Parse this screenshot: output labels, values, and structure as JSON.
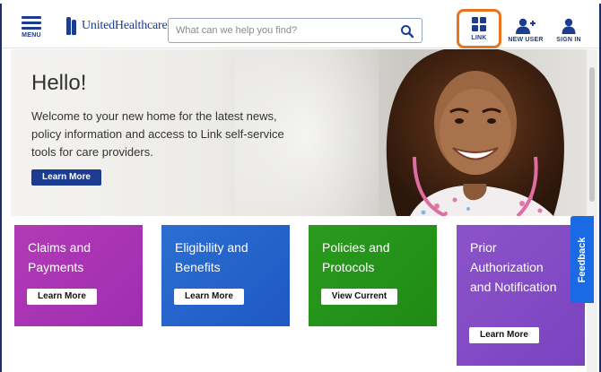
{
  "topstrip": {
    "link_text": "",
    "tail_text": ""
  },
  "header": {
    "menu_label": "MENU",
    "logo_text": "UnitedHealthcare",
    "search_placeholder": "What can we help you find?",
    "nav": [
      {
        "label": "LINK",
        "icon": "grid-icon"
      },
      {
        "label": "NEW USER",
        "icon": "add-user-icon"
      },
      {
        "label": "SIGN IN",
        "icon": "person-icon"
      }
    ],
    "highlight_color": "#e8741f",
    "brand_color": "#1c3c8f"
  },
  "hero": {
    "heading": "Hello!",
    "body": "Welcome to your new home for the latest news, policy information and access to Link self-service tools for care providers.",
    "button_label": "Learn More"
  },
  "cards": [
    {
      "title": "Claims and Payments",
      "button_label": "Learn More",
      "color": "#a834b4"
    },
    {
      "title": "Eligibility and Benefits",
      "button_label": "Learn More",
      "color": "#2563ca"
    },
    {
      "title": "Policies and Protocols",
      "button_label": "View Current",
      "color": "#26921a"
    },
    {
      "title": "Prior Authorization and Notification",
      "button_label": "Learn More",
      "color": "#834bc4"
    }
  ],
  "feedback": {
    "label": "Feedback",
    "color": "#1a6ae6"
  }
}
